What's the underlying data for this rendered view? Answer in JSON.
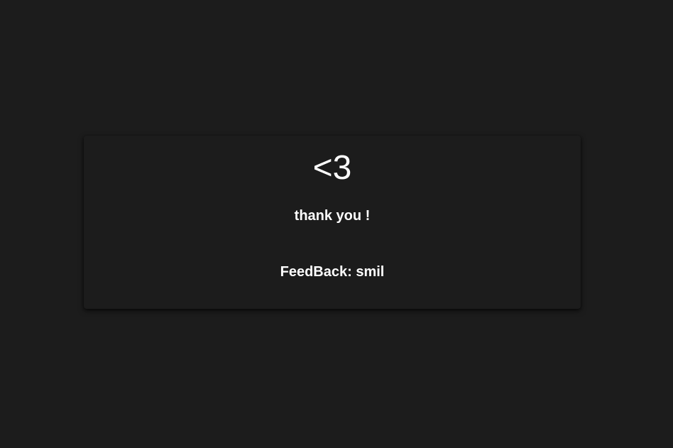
{
  "card": {
    "symbol": "<3",
    "message": "thank you !",
    "feedback": "FeedBack: smil"
  },
  "colors": {
    "background": "#1c1c1c",
    "text": "#ffffff"
  }
}
